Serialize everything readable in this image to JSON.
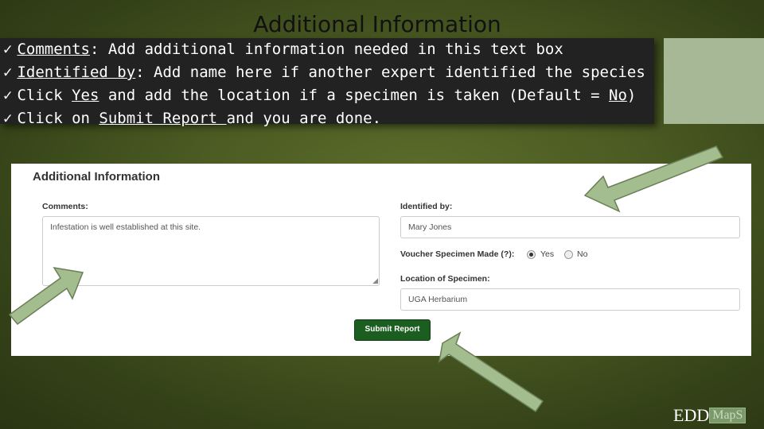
{
  "slide": {
    "title": "Additional Information",
    "bullets": [
      {
        "check": "ü",
        "term": "Comments",
        "rest": ": Add additional information needed in this text box"
      },
      {
        "check": "ü",
        "term": "Identified by",
        "rest": ": Add name here if another expert identified the species"
      },
      {
        "check": "ü",
        "pre": "Click ",
        "term": "Yes",
        "mid": " and add the location if a specimen is taken (Default = ",
        "term2": "No",
        "post": ")"
      },
      {
        "check": "ü",
        "pre": "Click on ",
        "term": "Submit Report ",
        "post": "and you are done."
      }
    ]
  },
  "form": {
    "title": "Additional Information",
    "comments_label": "Comments:",
    "comments_value": "Infestation is well established at this site.",
    "identified_label": "Identified by:",
    "identified_value": "Mary Jones",
    "voucher_label": "Voucher Specimen Made (?):",
    "voucher_yes": "Yes",
    "voucher_no": "No",
    "voucher_selected": "Yes",
    "location_label": "Location of Specimen:",
    "location_value": "UGA Herbarium",
    "submit_label": "Submit Report"
  },
  "logo": {
    "text": "EDD",
    "maps": "MapS"
  },
  "colors": {
    "arrow_fill": "#a3bd8f",
    "arrow_stroke": "#6a7f58",
    "submit_bg": "#1b5e20",
    "side_box": "#a6b895"
  }
}
